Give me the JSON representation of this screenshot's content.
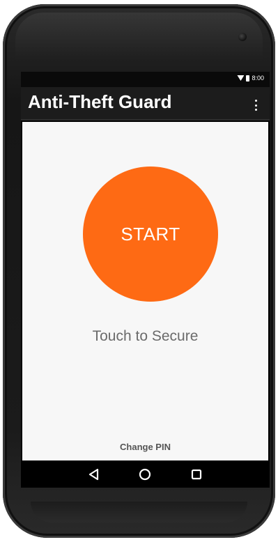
{
  "status_bar": {
    "time": "8:00"
  },
  "app_bar": {
    "title": "Anti-Theft Guard",
    "overflow_icon": "more-vert-icon"
  },
  "main": {
    "start_label": "START",
    "start_color": "#fe6a14",
    "touch_label": "Touch to Secure",
    "change_pin_label": "Change PIN"
  },
  "nav_bar": {
    "back_icon": "back-triangle-icon",
    "home_icon": "home-circle-icon",
    "recents_icon": "recents-square-icon"
  }
}
